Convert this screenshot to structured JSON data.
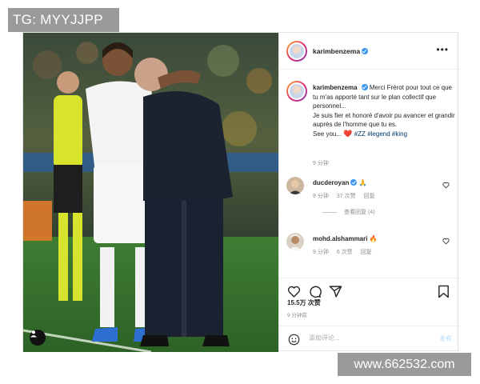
{
  "watermarks": {
    "top": "TG: MYYJJPP",
    "bottom": "www.662532.com"
  },
  "post": {
    "username": "karimbenzema",
    "verified": true,
    "more_icon": "more-horizontal-icon",
    "caption": {
      "username": "karimbenzema",
      "text_lines": [
        "Merci Frérot pour tout ce que tu m'as apporté tant sur le plan collectif que personnel...",
        "Je suis fier et honoré d'avoir pu avancer et grandir auprès de l'homme que tu es."
      ],
      "sign_off": "See you...",
      "emoji": "❤️",
      "hashtags": [
        "#ZZ",
        "#legend",
        "#king"
      ],
      "time": "9 分钟"
    },
    "comments": [
      {
        "username": "ducderoyan",
        "verified": true,
        "emoji": "🙏",
        "time": "9 分钟",
        "likes": "37 次赞",
        "reply": "回复",
        "view_replies": "查看回复 (4)"
      },
      {
        "username": "mohd.alshammari",
        "verified": false,
        "emoji": "🔥",
        "time": "9 分钟",
        "likes": "6 次赞",
        "reply": "回复"
      }
    ],
    "likes_count": "15.5万 次赞",
    "post_time": "9 分钟前",
    "comment_placeholder": "添加评论...",
    "post_button": "发布",
    "colors": {
      "link": "#00376b",
      "verified": "#3897f0",
      "post_button_disabled": "#b3dbff",
      "heart": "#d32f2f"
    }
  }
}
